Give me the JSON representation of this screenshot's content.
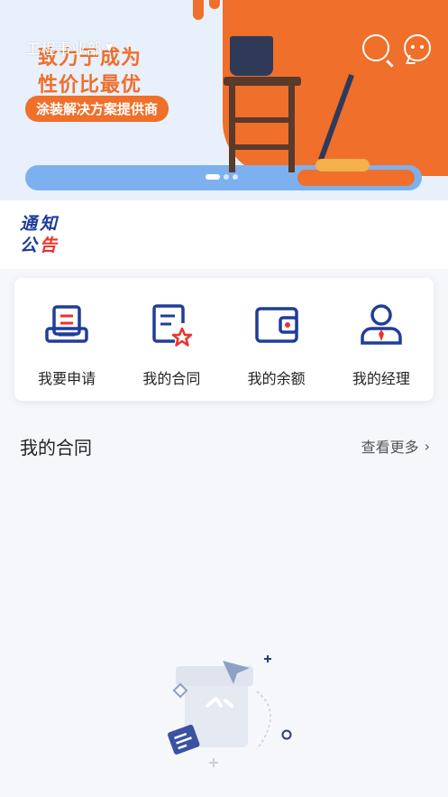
{
  "banner": {
    "city": "工程事业部",
    "slogan_line1": "致力于成为",
    "slogan_line2": "性价比最优",
    "slogan_tag": "涂装解决方案提供商",
    "slide_count": 3,
    "active_slide": 1
  },
  "header": {
    "search_icon": "search-icon",
    "message_icon": "message-icon"
  },
  "notice": {
    "line1": "通知",
    "line2_part1": "公",
    "line2_part2": "告"
  },
  "quick_actions": [
    {
      "label": "我要申请",
      "icon": "apply-icon"
    },
    {
      "label": "我的合同",
      "icon": "contract-icon"
    },
    {
      "label": "我的余额",
      "icon": "wallet-icon"
    },
    {
      "label": "我的经理",
      "icon": "manager-icon"
    }
  ],
  "contracts_section": {
    "title": "我的合同",
    "view_more": "查看更多"
  },
  "colors": {
    "brand_blue": "#1f3d9a",
    "accent_red": "#e8342c",
    "banner_orange": "#ef6f2b"
  }
}
